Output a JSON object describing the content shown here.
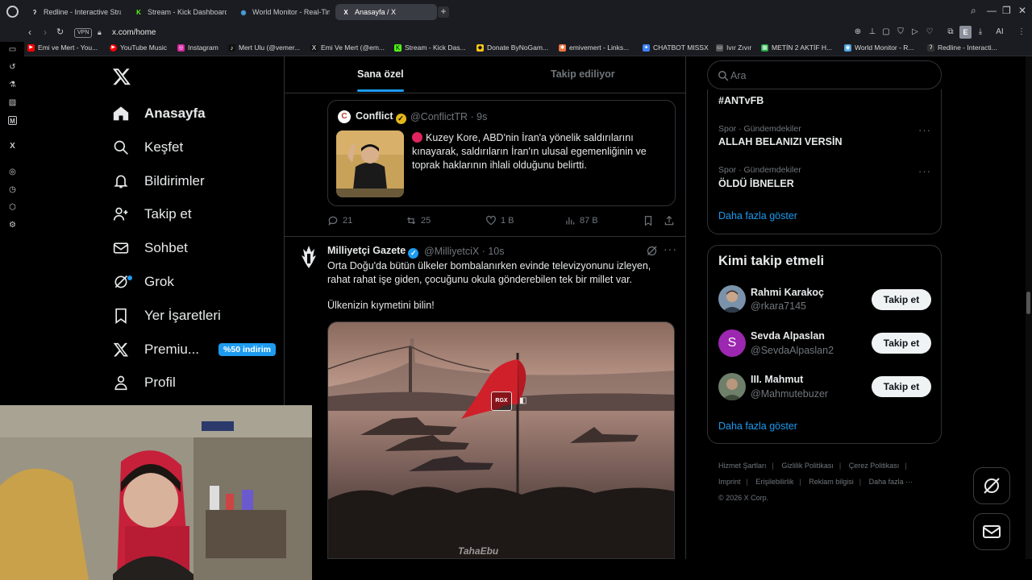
{
  "browser": {
    "tabs": [
      {
        "title": "Redline - Interactive Strate",
        "fav": "ʔ",
        "fav_color": "#dddddd"
      },
      {
        "title": "Stream - Kick Dashboard",
        "fav": "K",
        "fav_color": "#53fc18"
      },
      {
        "title": "World Monitor - Real-Tim",
        "fav": "◉",
        "fav_color": "#4aa3df"
      },
      {
        "title": "Anasayfa / X",
        "fav": "X",
        "fav_color": "#ffffff"
      }
    ],
    "url": "x.com/home",
    "vpn_label": "VPN",
    "ai_label": "AI",
    "profile_letter": "E",
    "bookmarks": [
      {
        "label": "Emi ve Mert - You...",
        "color": "#ff0000",
        "glyph": "▶"
      },
      {
        "label": "YouTube Music",
        "color": "#ff0000",
        "glyph": "●"
      },
      {
        "label": "Instagram",
        "color": "#d6249f",
        "glyph": "◎"
      },
      {
        "label": "Mert Ulu (@vemer...",
        "color": "#111111",
        "glyph": "♪"
      },
      {
        "label": "Emi Ve Mert (@em...",
        "color": "#111111",
        "glyph": "X"
      },
      {
        "label": "Stream - Kick Das...",
        "color": "#53fc18",
        "glyph": "K"
      },
      {
        "label": "Donate ByNoGam...",
        "color": "#f5c518",
        "glyph": "◆"
      },
      {
        "label": "emivemert - Links...",
        "color": "#e8743b",
        "glyph": "✱"
      },
      {
        "label": "CHATBOT MISSX",
        "color": "#3b82f6",
        "glyph": "✦"
      },
      {
        "label": "Ivır Zıvır",
        "color": "#555555",
        "glyph": "▭"
      },
      {
        "label": "METİN 2 AKTİF H...",
        "color": "#22aa44",
        "glyph": "▦"
      },
      {
        "label": "World Monitor - R...",
        "color": "#4aa3df",
        "glyph": "◉"
      },
      {
        "label": "Redline - Interacti...",
        "color": "#333333",
        "glyph": "ʔ"
      }
    ]
  },
  "nav": {
    "items": [
      {
        "label": "Anasayfa",
        "icon": "home-icon",
        "active": true
      },
      {
        "label": "Keşfet",
        "icon": "search-icon"
      },
      {
        "label": "Bildirimler",
        "icon": "bell-icon"
      },
      {
        "label": "Takip et",
        "icon": "follow-icon"
      },
      {
        "label": "Sohbet",
        "icon": "mail-icon"
      },
      {
        "label": "Grok",
        "icon": "grok-icon"
      },
      {
        "label": "Yer İşaretleri",
        "icon": "bookmark-icon"
      },
      {
        "label": "Premiu...",
        "icon": "x-premium-icon",
        "badge": "%50 indirim"
      },
      {
        "label": "Profil",
        "icon": "profile-icon"
      }
    ]
  },
  "feed": {
    "tabs": [
      {
        "label": "Sana özel",
        "active": true
      },
      {
        "label": "Takip ediliyor",
        "active": false
      }
    ],
    "quote": {
      "name": "Conflict",
      "handle": "@ConflictTR · 9s",
      "text": "Kuzey Kore, ABD'nin İran'a yönelik saldırılarını kınayarak, saldırıların İran'ın ulusal egemenliğinin ve toprak haklarının ihlali olduğunu belirtti."
    },
    "quote_actions": {
      "replies": "21",
      "reposts": "25",
      "likes": "1 B",
      "views": "87 B"
    },
    "post": {
      "name": "Milliyetçi Gazete",
      "handle": "@MilliyetciX · 10s",
      "text": "Orta Doğu'da bütün ülkeler bombalanırken evinde televizyonunu izleyen, rahat rahat işe giden, çocuğunu okula gönderebilen tek bir millet var.",
      "text2": "Ülkenizin kıymetini bilin!",
      "media_badge": "RGX",
      "watermark": "TahaEbu"
    }
  },
  "right": {
    "search_placeholder": "Ara",
    "trends": [
      {
        "meta": "",
        "title": "#ANTvFB"
      },
      {
        "meta": "Spor · Gündemdekiler",
        "title": "ALLAH BELANIZI VERSİN"
      },
      {
        "meta": "Spor · Gündemdekiler",
        "title": "ÖLDÜ İBNELER"
      }
    ],
    "trends_more": "Daha fazla göster",
    "who_to_follow": {
      "title": "Kimi takip etmeli",
      "users": [
        {
          "name": "Rahmi Karakoç",
          "handle": "@rkara7145",
          "avatar_color": "#6b8aa8",
          "letter": ""
        },
        {
          "name": "Sevda Alpaslan",
          "handle": "@SevdaAlpaslan2",
          "avatar_color": "#9c27b0",
          "letter": "S"
        },
        {
          "name": "III. Mahmut",
          "handle": "@Mahmutebuzer",
          "avatar_color": "#5a6e5a",
          "letter": ""
        }
      ],
      "follow_label": "Takip et",
      "more": "Daha fazla göster"
    },
    "footer": {
      "links": [
        "Hizmet Şartları",
        "Gizlilik Politikası",
        "Çerez Politikası",
        "Imprint",
        "Erişilebilirlik",
        "Reklam bilgisi",
        "Daha fazla ···"
      ],
      "copyright": "© 2026 X Corp."
    }
  }
}
